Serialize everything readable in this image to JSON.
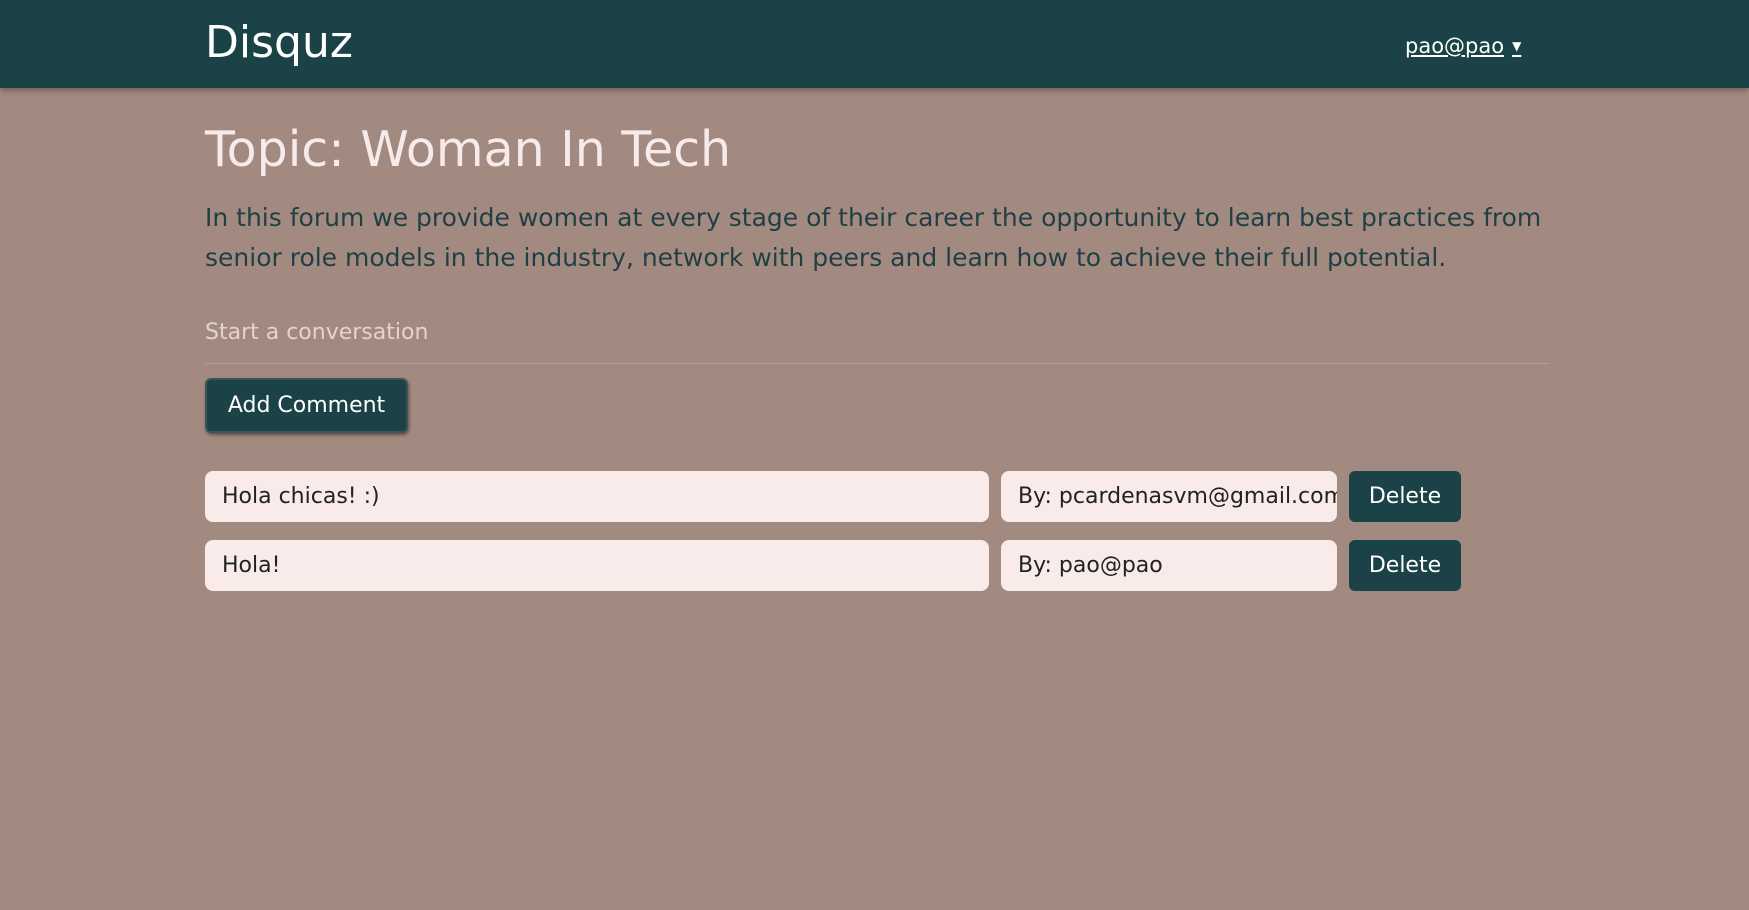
{
  "navbar": {
    "brand": "Disquz",
    "user_label": "pao@pao",
    "caret": "▼"
  },
  "topic": {
    "title": "Topic: Woman In Tech",
    "description": "In this forum we provide women at every stage of their career the opportunity to learn best practices from senior role models in the industry, network with peers and learn how to achieve their full potential."
  },
  "composer": {
    "placeholder": "Start a conversation",
    "add_label": "Add Comment"
  },
  "comments": [
    {
      "text": "Hola chicas! :)",
      "author": "By: pcardenasvm@gmail.com",
      "delete_label": "Delete"
    },
    {
      "text": "Hola!",
      "author": "By: pao@pao",
      "delete_label": "Delete"
    }
  ],
  "colors": {
    "navbar": "#1b4247",
    "background": "#a38a81",
    "card": "#f8ebea",
    "button": "#1b4247"
  }
}
